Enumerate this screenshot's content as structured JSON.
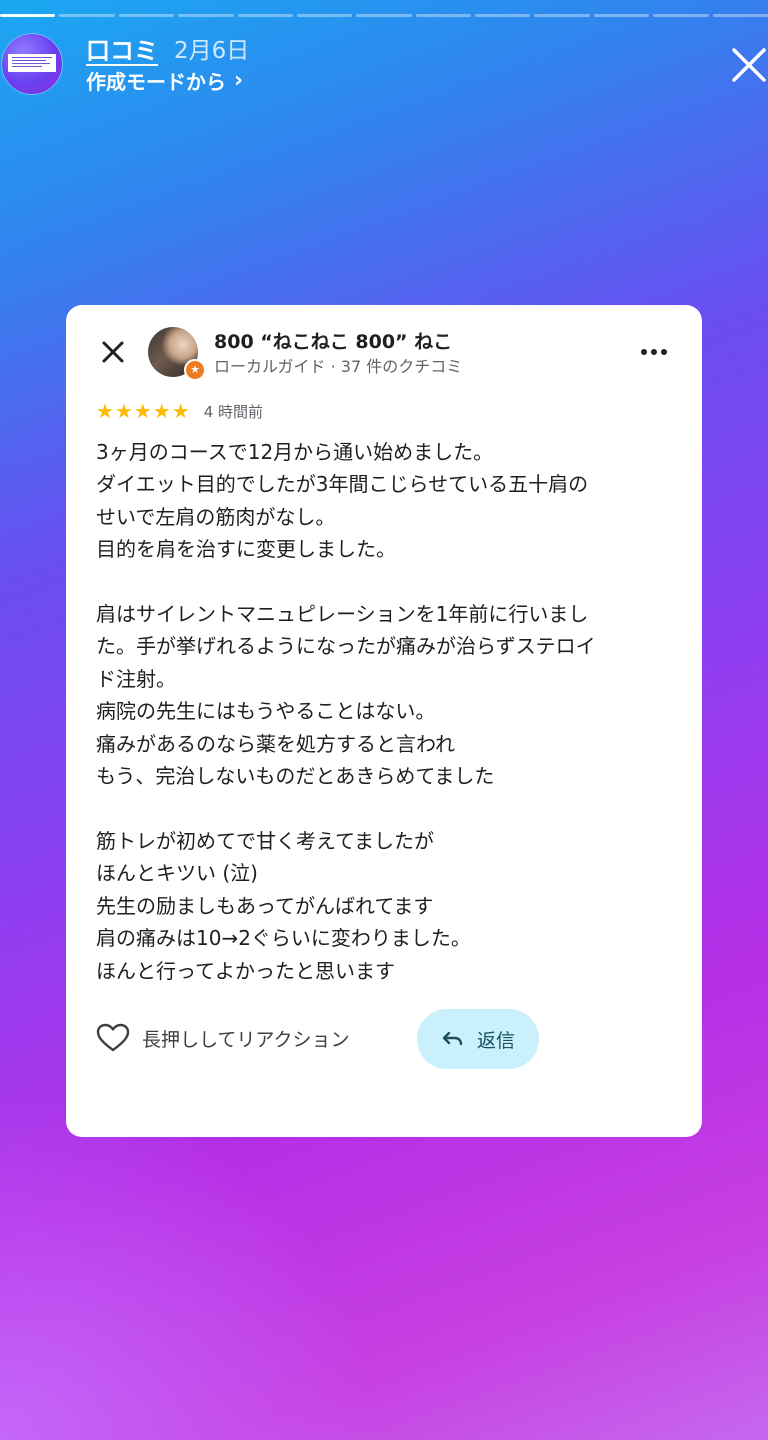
{
  "story": {
    "progress_segments": 13,
    "completed_segments": 1,
    "current_segment": 2
  },
  "header": {
    "account_name": "口コミ",
    "date": "2月6日",
    "subtitle": "作成モードから",
    "subtitle_chevron": "›"
  },
  "review": {
    "reviewer_name": "800 “ねこねこ 800” ねこ",
    "reviewer_meta": "ローカルガイド · 37 件のクチコミ",
    "rating": 5,
    "time": "4 時間前",
    "text": "3ヶ月のコースで12月から通い始めました。\nダイエット目的でしたが3年間こじらせている五十肩の\nせいで左肩の筋肉がなし。\n目的を肩を治すに変更しました。\n\n肩はサイレントマニュピレーションを1年前に行いまし\nた。手が挙げれるようになったが痛みが治らずステロイ\nド注射。\n病院の先生にはもうやることはない。\n痛みがあるのなら薬を処方すると言われ\nもう、完治しないものだとあきらめてました\n\n筋トレが初めてで甘く考えてましたが\nほんとキツい (泣)\n先生の励ましもあってがんばれてます\n肩の痛みは10→2ぐらいに変わりました。\nほんと行ってよかったと思います",
    "reaction_label": "長押ししてリアクション",
    "reply_label": "返信"
  },
  "colors": {
    "star": "#fbbc04",
    "reply_button_bg": "#c9f0fb",
    "guide_badge": "#ef7b21"
  }
}
